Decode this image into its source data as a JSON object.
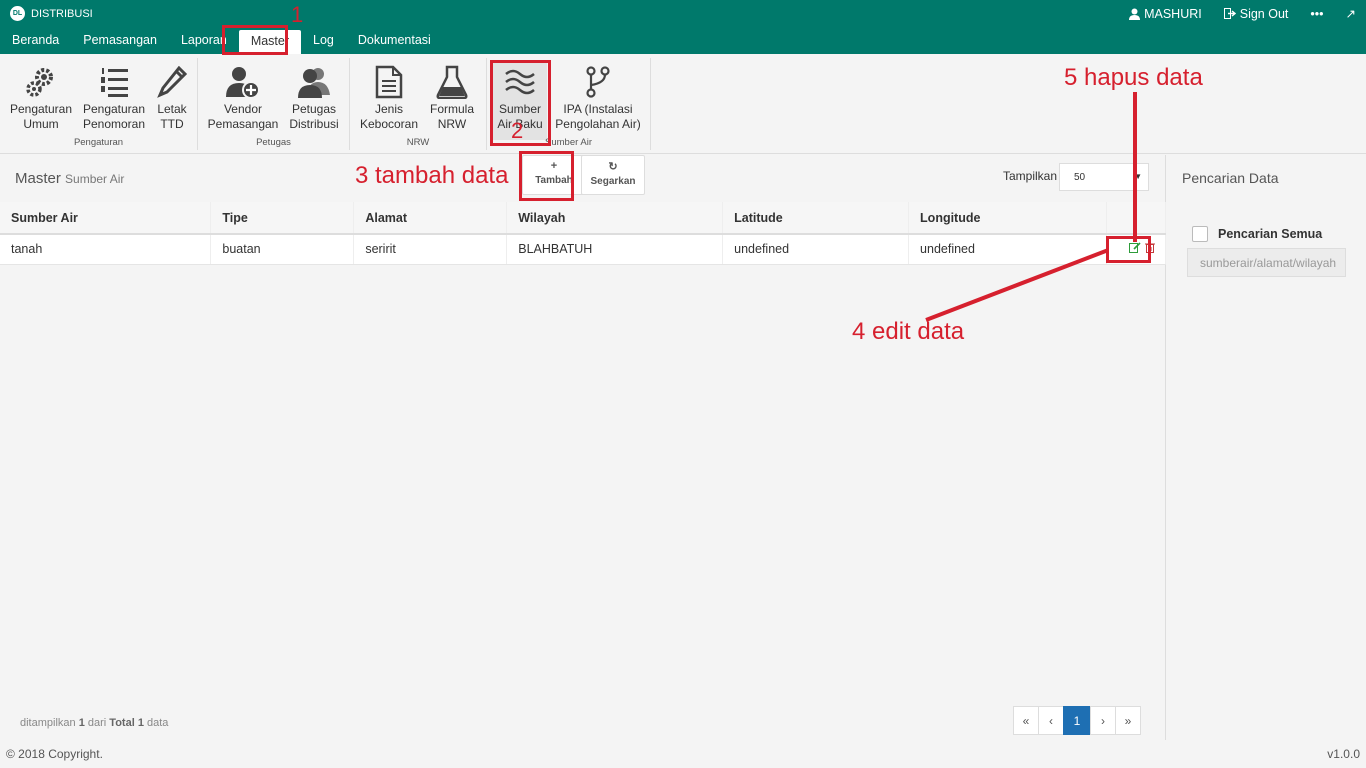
{
  "app": {
    "name": "DISTRIBUSI",
    "logo_text": "DL",
    "user_name": "MASHURI",
    "sign_out_label": "Sign Out",
    "more_label": "•••",
    "external_label": "↗"
  },
  "menu": {
    "items": [
      {
        "label": "Beranda"
      },
      {
        "label": "Pemasangan"
      },
      {
        "label": "Laporan"
      },
      {
        "label": "Master"
      },
      {
        "label": "Log"
      },
      {
        "label": "Dokumentasi"
      }
    ],
    "active": "Master"
  },
  "ribbon": {
    "groups": [
      {
        "label": "Pengaturan",
        "buttons": [
          {
            "line1": "Pengaturan",
            "line2": "Umum",
            "icon": "gears-icon"
          },
          {
            "line1": "Pengaturan",
            "line2": "Penomoran",
            "icon": "numbered-list-icon"
          },
          {
            "line1": "Letak",
            "line2": "TTD",
            "icon": "pencil-icon"
          }
        ]
      },
      {
        "label": "Petugas",
        "buttons": [
          {
            "line1": "Vendor",
            "line2": "Pemasangan",
            "icon": "user-add-icon"
          },
          {
            "line1": "Petugas",
            "line2": "Distribusi",
            "icon": "users-icon"
          }
        ]
      },
      {
        "label": "NRW",
        "buttons": [
          {
            "line1": "Jenis",
            "line2": "Kebocoran",
            "icon": "document-icon"
          },
          {
            "line1": "Formula",
            "line2": "NRW",
            "icon": "flask-icon"
          }
        ]
      },
      {
        "label": "Sumber Air",
        "buttons": [
          {
            "line1": "Sumber",
            "line2": "Air Baku",
            "icon": "waves-icon"
          },
          {
            "line1": "IPA (Instalasi",
            "line2": "Pengolahan Air)",
            "icon": "branch-icon"
          }
        ]
      }
    ]
  },
  "main": {
    "title": "Master",
    "subtitle": "Sumber Air",
    "add_label": "Tambah",
    "add_icon": "+",
    "refresh_label": "Segarkan",
    "refresh_icon": "↻",
    "show_label": "Tampilkan",
    "show_value": "50",
    "table": {
      "columns": [
        "Sumber Air",
        "Tipe",
        "Alamat",
        "Wilayah",
        "Latitude",
        "Longitude"
      ],
      "rows": [
        [
          "tanah",
          "buatan",
          "seririt",
          "BLAHBATUH",
          "undefined",
          "undefined"
        ]
      ]
    },
    "footer": {
      "prefix": "ditampilkan",
      "shown": "1",
      "middle": "dari",
      "total_label": "Total",
      "total": "1",
      "suffix": "data"
    },
    "pagination": {
      "first": "«",
      "prev": "‹",
      "current": "1",
      "next": "›",
      "last": "»"
    }
  },
  "side": {
    "title": "Pencarian Data",
    "search_all_label": "Pencarian Semua",
    "search_placeholder": "sumberair/alamat/wilayah"
  },
  "footer": {
    "copyright": "© 2018 Copyright.",
    "version": "v1.0.0"
  },
  "annotations": {
    "step1": "1",
    "step2": "2",
    "step3": "3 tambah data",
    "step4": "4 edit data",
    "step5": "5 hapus data"
  },
  "colors": {
    "header_bg": "#00796b",
    "annotation": "#d6202e",
    "pagination_active": "#1e6fb3"
  }
}
